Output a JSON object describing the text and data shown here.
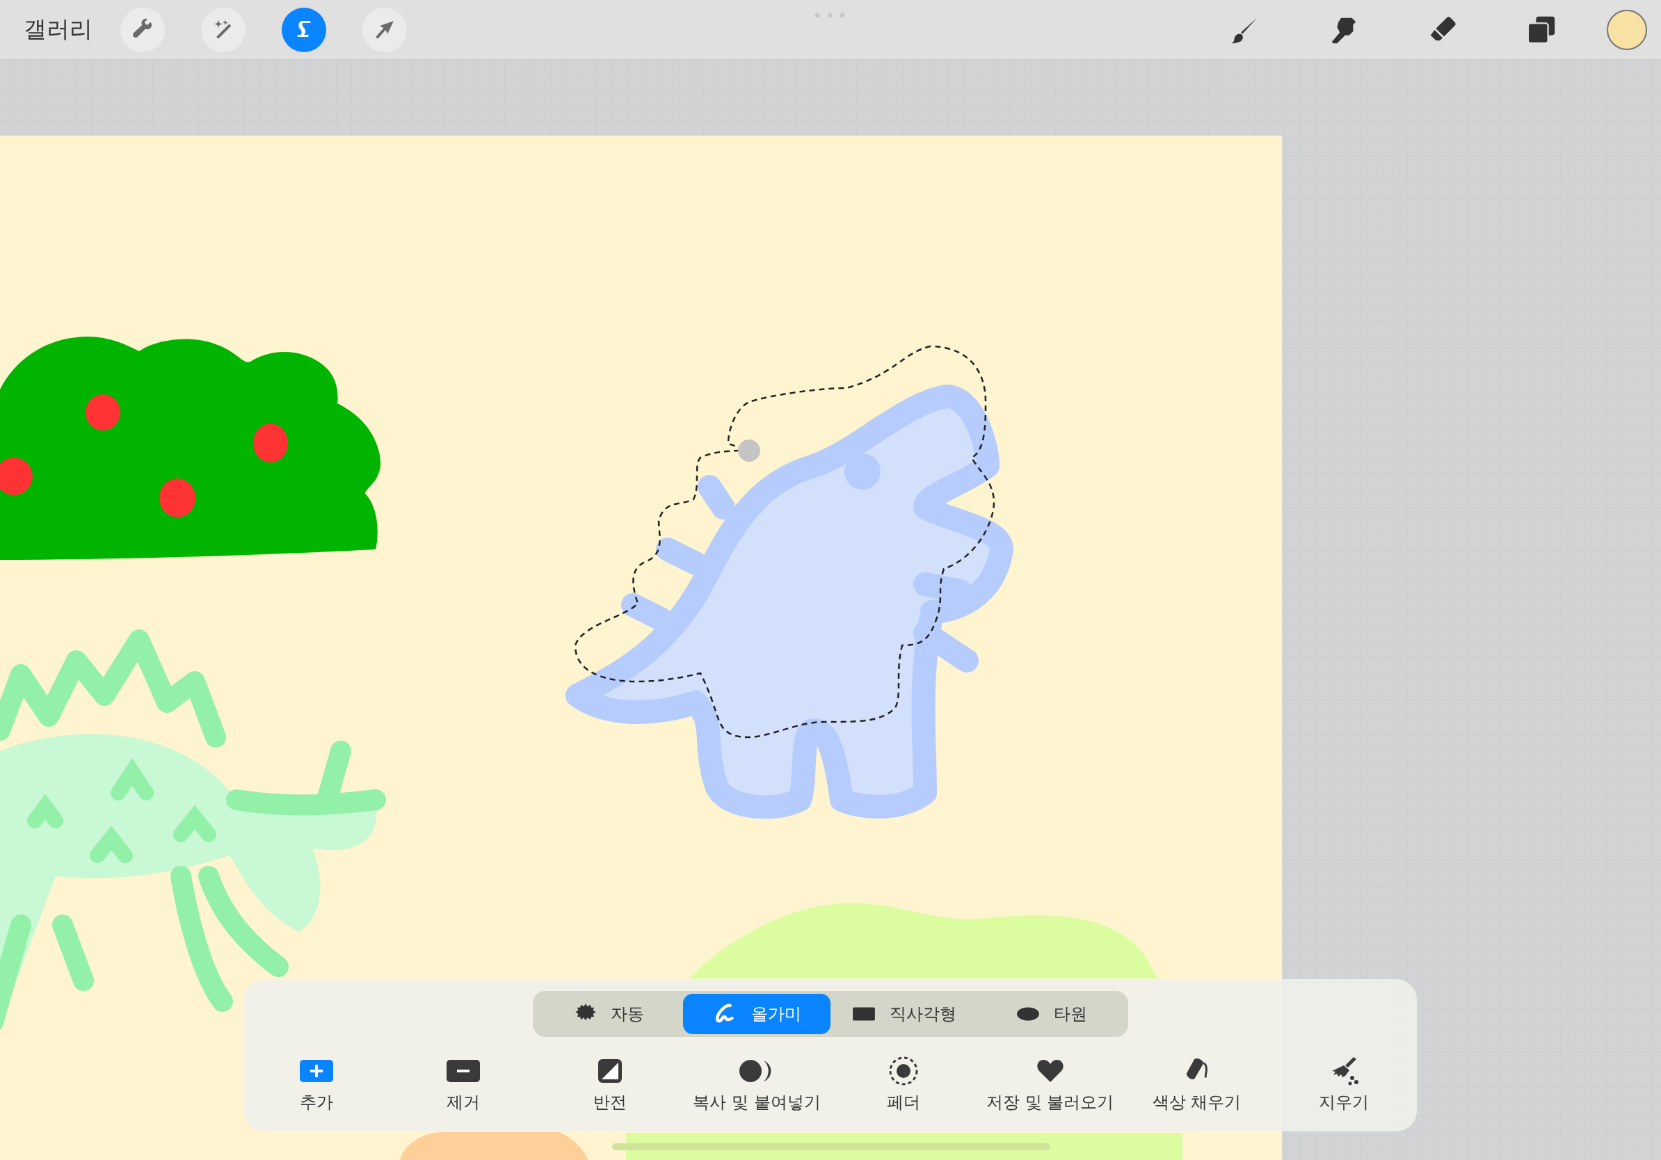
{
  "top_bar": {
    "gallery": "갤러리",
    "left_tools": [
      {
        "kind": "wrench",
        "selected": false
      },
      {
        "kind": "wand",
        "selected": false
      },
      {
        "kind": "selection",
        "selected": true
      },
      {
        "kind": "arrow",
        "selected": false
      }
    ],
    "right_tools": [
      {
        "kind": "brush",
        "selected": false
      },
      {
        "kind": "smudge",
        "selected": false
      },
      {
        "kind": "eraser",
        "selected": false
      },
      {
        "kind": "layers",
        "selected": false
      }
    ],
    "current_color": {
      "color": "#f7e2a4"
    }
  },
  "selection_toolbar": {
    "modes": [
      {
        "kind": "auto",
        "label": "자동",
        "selected": false
      },
      {
        "kind": "lasso",
        "label": "올가미",
        "selected": true
      },
      {
        "kind": "rectangle",
        "label": "직사각형",
        "selected": false
      },
      {
        "kind": "ellipse",
        "label": "타원",
        "selected": false
      }
    ],
    "actions": [
      {
        "kind": "add",
        "label": "추가"
      },
      {
        "kind": "remove",
        "label": "제거"
      },
      {
        "kind": "invert",
        "label": "반전"
      },
      {
        "kind": "copy",
        "label": "복사 및 붙여넣기"
      },
      {
        "kind": "feather",
        "label": "페더"
      },
      {
        "kind": "save",
        "label": "저장 및 불러오기"
      },
      {
        "kind": "fill",
        "label": "색상 채우기"
      },
      {
        "kind": "clear",
        "label": "지우기"
      }
    ]
  }
}
